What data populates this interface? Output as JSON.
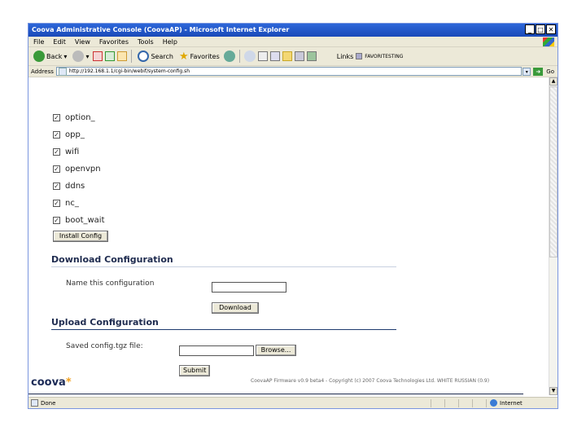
{
  "window": {
    "title": "Coova Administrative Console (CoovaAP) - Microsoft Internet Explorer",
    "controls": {
      "minimize": "_",
      "maximize": "□",
      "close": "✕"
    }
  },
  "menu": [
    "File",
    "Edit",
    "View",
    "Favorites",
    "Tools",
    "Help"
  ],
  "toolbar": {
    "back": "Back",
    "search": "Search",
    "favorites": "Favorites",
    "links": "Links",
    "links_item": "FAVORITESTING"
  },
  "address": {
    "label": "Address",
    "url": "http://192.168.1.1/cgi-bin/webif/system-config.sh",
    "go": "Go"
  },
  "checkboxes": [
    {
      "label": "option_",
      "checked": true
    },
    {
      "label": "opp_",
      "checked": true
    },
    {
      "label": "wifi",
      "checked": true
    },
    {
      "label": "openvpn",
      "checked": true
    },
    {
      "label": "ddns",
      "checked": true
    },
    {
      "label": "nc_",
      "checked": true
    },
    {
      "label": "boot_wait",
      "checked": true
    }
  ],
  "install_button": "Install Config",
  "download": {
    "title": "Download Configuration",
    "name_label": "Name this configuration",
    "name_value": "",
    "button": "Download"
  },
  "upload": {
    "title": "Upload Configuration",
    "file_label": "Saved config.tgz file:",
    "file_value": "",
    "browse_button": "Browse...",
    "submit_button": "Submit"
  },
  "footer": {
    "logo": "coova",
    "text": "CoovaAP Firmware v0.9 beta4 - Copyright (c) 2007 Coova Technologies Ltd. WHITE RUSSIAN (0.9)"
  },
  "status": {
    "left": "Done",
    "zone": "Internet"
  },
  "colors": {
    "titlebar": "#1a49b8",
    "heading": "#1e2b4f",
    "logo_star": "#f0a020"
  }
}
